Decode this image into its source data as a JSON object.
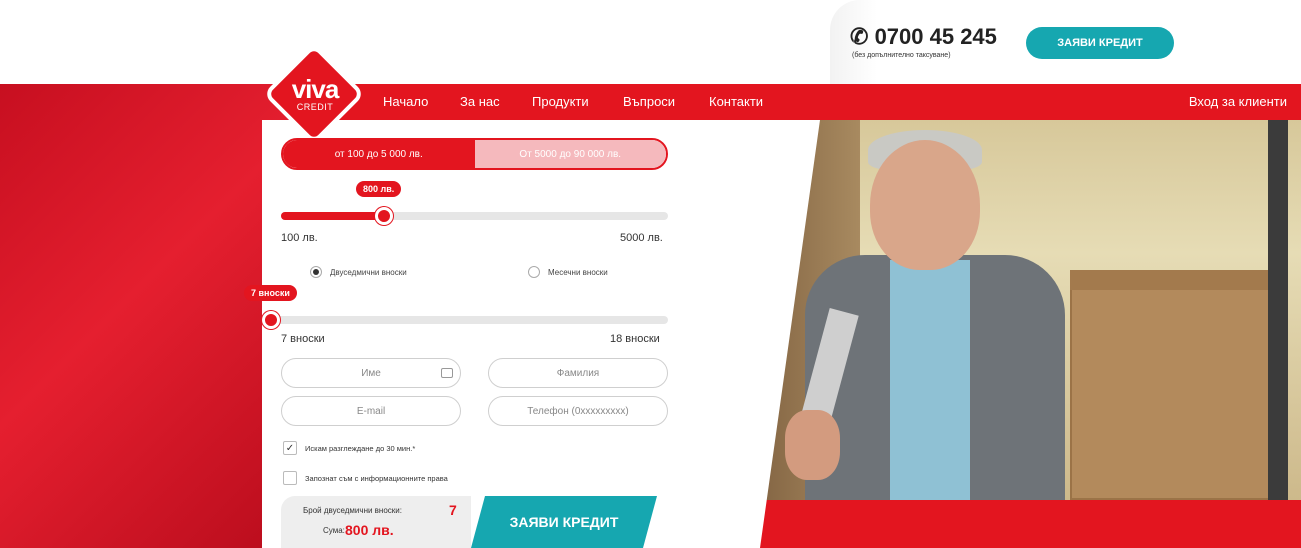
{
  "header": {
    "phone": "0700 45 245",
    "phone_note": "(без допълнително таксуване)",
    "cta_label": "ЗАЯВИ КРЕДИТ"
  },
  "logo": {
    "word1": "viva",
    "word2": "CREDIT"
  },
  "nav": {
    "items": [
      "Начало",
      "За нас",
      "Продукти",
      "Въпроси",
      "Контакти"
    ],
    "login": "Вход за клиенти"
  },
  "calculator": {
    "range_options": [
      "от 100 до 5 000 лв.",
      "От 5000 до 90 000 лв."
    ],
    "amount": {
      "bubble": "800 лв.",
      "min_label": "100 лв.",
      "max_label": "5000 лв.",
      "min": 100,
      "max": 5000,
      "value": 800
    },
    "installment_types": [
      "Двуседмични вноски",
      "Месечни вноски"
    ],
    "installments": {
      "bubble": "7 вноски",
      "min_label": "7 вноски",
      "max_label": "18 вноски",
      "min": 7,
      "max": 18,
      "value": 7
    },
    "fields": {
      "first_name": "Име",
      "last_name": "Фамилия",
      "email": "E-mail",
      "phone": "Телефон (0xxxxxxxxx)"
    },
    "checkboxes": {
      "review": "Искам разглеждане до 30 мин.*",
      "rights": "Запознат съм с информационните права"
    },
    "summary": {
      "count_label": "Брой двуседмични вноски:",
      "count_value": "7",
      "sum_label": "Сума:",
      "sum_value": "800 лв."
    },
    "submit_label": "ЗАЯВИ КРЕДИТ"
  },
  "colors": {
    "brand_red": "#e3151f",
    "teal": "#16a7b0"
  }
}
